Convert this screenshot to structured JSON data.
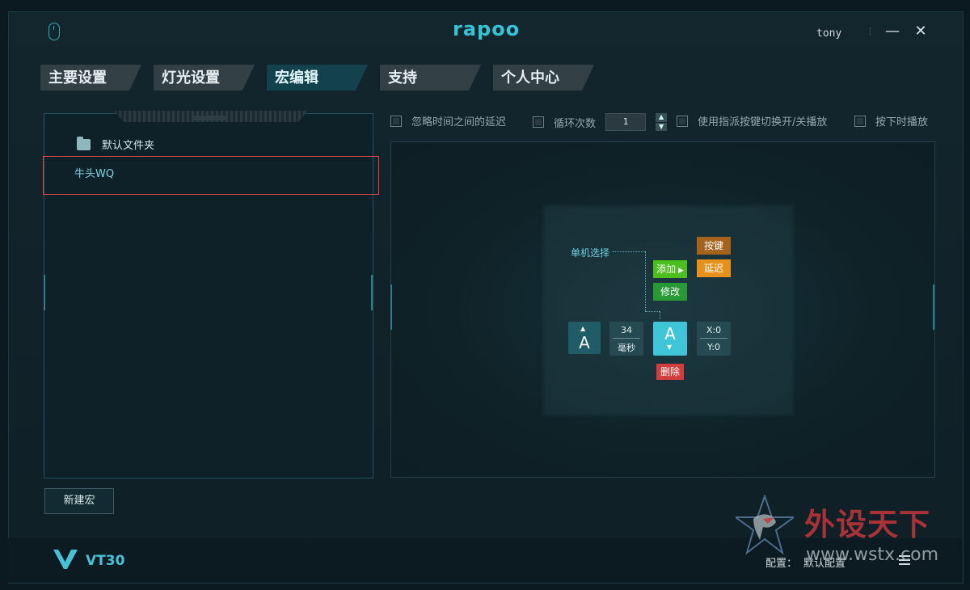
{
  "brand": "rapoo",
  "user": {
    "name": "tony"
  },
  "window": {
    "minimize_icon": "minus-icon",
    "close_icon": "close-icon"
  },
  "tabs": [
    {
      "label": "主要设置",
      "active": false
    },
    {
      "label": "灯光设置",
      "active": false
    },
    {
      "label": "宏编辑",
      "active": true
    },
    {
      "label": "支持",
      "active": false
    },
    {
      "label": "个人中心",
      "active": false
    }
  ],
  "sidebar": {
    "folder_label": "默认文件夹",
    "macro_item": "牛头WQ",
    "new_macro_button": "新建宏"
  },
  "options": {
    "ignore_delay": "忽略时间之间的延迟",
    "loop_count_label": "循环次数",
    "loop_count_value": "1",
    "toggle_play": "使用指派按键切换开/关播放",
    "press_play": "按下时播放"
  },
  "editor": {
    "single_select": "单机选择",
    "key_button": "按键",
    "delay_button": "延迟",
    "add_button": "添加",
    "modify_button": "修改",
    "delete_button": "删除",
    "key_up_char": "A",
    "delay_value": "34",
    "delay_unit": "毫秒",
    "key_down_char": "A",
    "x_value": "X:0",
    "y_value": "Y:0"
  },
  "footer": {
    "model": "VT30",
    "config_label": "配置：",
    "config_value": "默认配置"
  },
  "watermark": {
    "text": "外设天下",
    "url": "www.wstx.com"
  },
  "colors": {
    "accent": "#3ec5d8",
    "key_orange": "#a5621a",
    "delay_orange": "#e8901c",
    "add_green": "#4bbf1e",
    "modify_green": "#279a35",
    "delete_red": "#d23d3d"
  }
}
